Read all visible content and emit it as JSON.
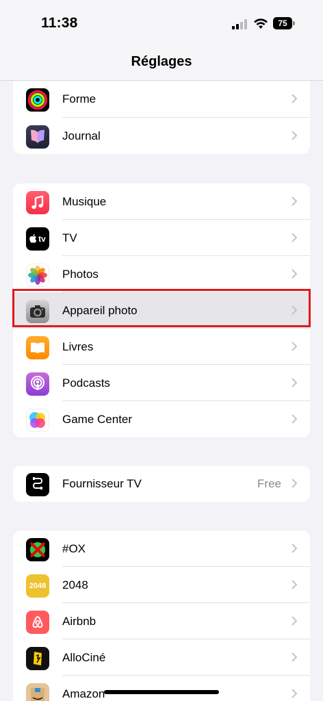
{
  "status": {
    "time": "11:38",
    "battery": "75"
  },
  "nav": {
    "title": "Réglages"
  },
  "group1": [
    {
      "label": "Forme",
      "icon": "fitness-icon"
    },
    {
      "label": "Journal",
      "icon": "journal-icon"
    }
  ],
  "group2": [
    {
      "label": "Musique",
      "icon": "music-icon"
    },
    {
      "label": "TV",
      "icon": "tv-icon",
      "icon_text": "tv"
    },
    {
      "label": "Photos",
      "icon": "photos-icon"
    },
    {
      "label": "Appareil photo",
      "icon": "camera-icon"
    },
    {
      "label": "Livres",
      "icon": "books-icon"
    },
    {
      "label": "Podcasts",
      "icon": "podcasts-icon"
    },
    {
      "label": "Game Center",
      "icon": "game-center-icon"
    }
  ],
  "group3": [
    {
      "label": "Fournisseur TV",
      "value": "Free",
      "icon": "tv-provider-icon"
    }
  ],
  "group4": [
    {
      "label": "#OX",
      "icon": "ox-game-icon"
    },
    {
      "label": "2048",
      "icon": "2048-icon",
      "icon_text": "2048"
    },
    {
      "label": "Airbnb",
      "icon": "airbnb-icon"
    },
    {
      "label": "AlloCiné",
      "icon": "allocine-icon"
    },
    {
      "label": "Amazon",
      "icon": "amazon-icon"
    }
  ],
  "colors": {
    "highlight": "#e0191e",
    "music": "#fb3c58",
    "podcasts": "#a84ef0",
    "books": "#ff9a0a"
  }
}
